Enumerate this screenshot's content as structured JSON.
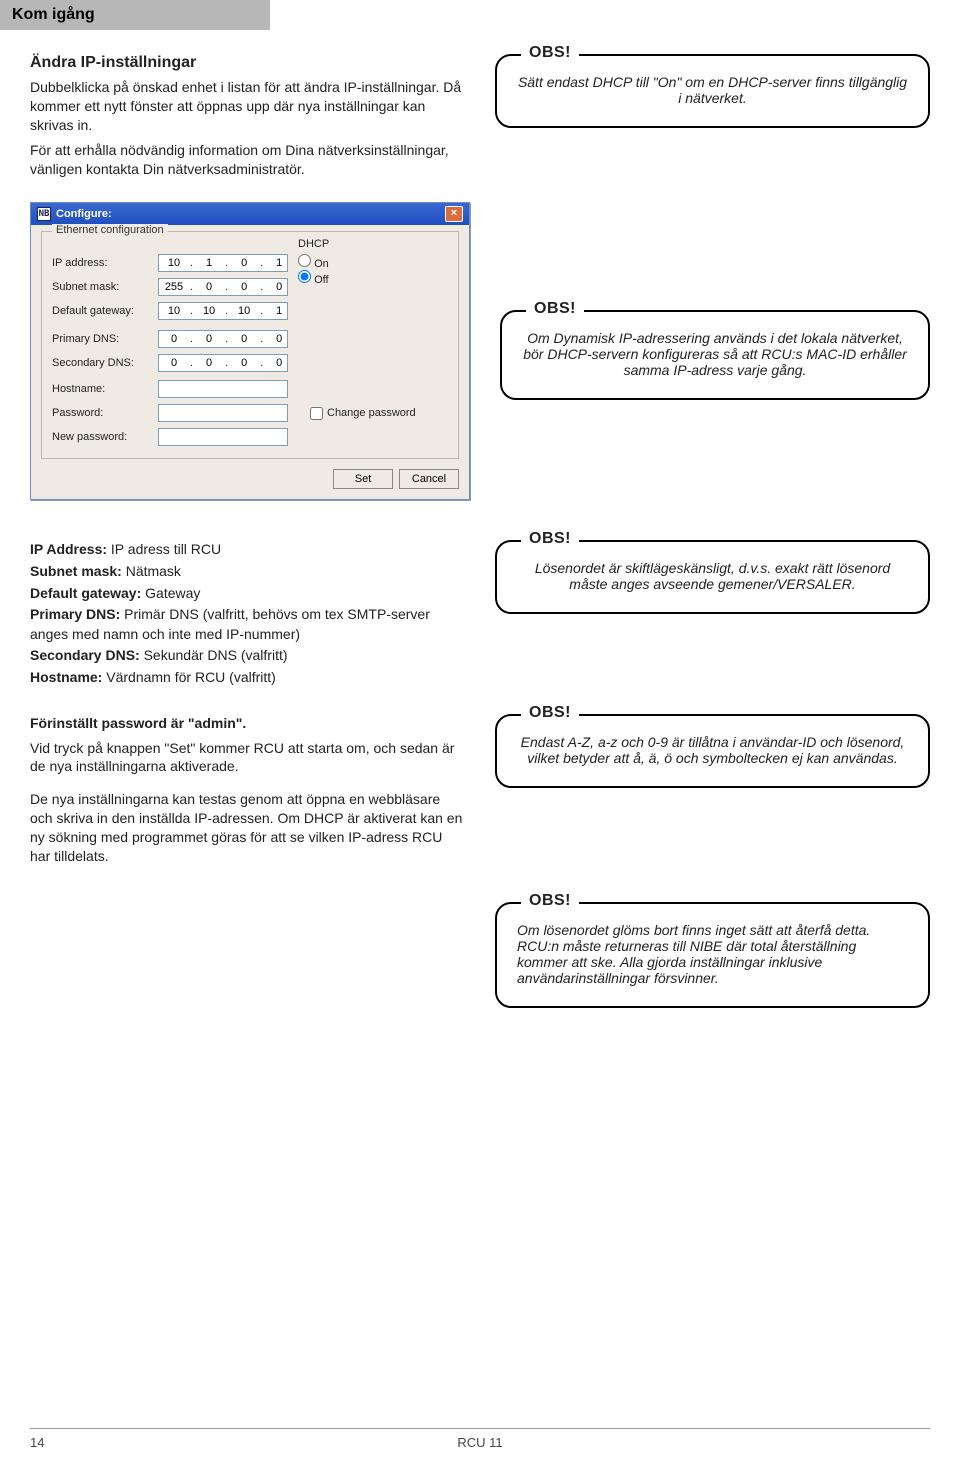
{
  "header_band": "Kom igång",
  "section1": {
    "title": "Ändra IP-inställningar",
    "p1": "Dubbelklicka på önskad enhet i listan för att ändra IP-inställningar. Då kommer ett nytt fönster att öppnas upp där nya inställningar kan skrivas in.",
    "p2": "För att erhålla nödvändig information om Dina nätverksinställningar, vänligen kontakta Din nätverksadministratör."
  },
  "callout1": {
    "legend": "OBS!",
    "text": "Sätt endast DHCP till \"On\" om en DHCP-server finns tillgänglig i nätverket."
  },
  "callout2": {
    "legend": "OBS!",
    "text": "Om Dynamisk IP-adressering används i det lokala nätverket, bör DHCP-servern konfigureras så att RCU:s MAC-ID erhåller samma IP-adress varje gång."
  },
  "callout3": {
    "legend": "OBS!",
    "text": "Lösenordet är skiftlägeskänsligt, d.v.s. exakt rätt lösenord måste anges avseende gemener/VERSALER."
  },
  "callout4": {
    "legend": "OBS!",
    "text": "Endast A-Z, a-z och 0-9 är tillåtna i användar-ID och lösenord, vilket betyder att å, ä, ö och symboltecken ej kan användas."
  },
  "callout5": {
    "legend": "OBS!",
    "text": "Om lösenordet glöms bort finns inget sätt att återfå detta. RCU:n måste returneras till NIBE där total återställning kommer att ske. Alla gjorda inställningar inklusive användarinställningar försvinner."
  },
  "dialog": {
    "title": "Configure:",
    "fieldset_legend": "Ethernet configuration",
    "labels": {
      "ip": "IP address:",
      "subnet": "Subnet mask:",
      "gw": "Default gateway:",
      "pdns": "Primary DNS:",
      "sdns": "Secondary DNS:",
      "host": "Hostname:",
      "pw": "Password:",
      "npw": "New password:",
      "dhcp": "DHCP",
      "on": "On",
      "off": "Off",
      "chgpw": "Change password"
    },
    "values": {
      "ip": [
        "10",
        "1",
        "0",
        "1"
      ],
      "subnet": [
        "255",
        "0",
        "0",
        "0"
      ],
      "gw": [
        "10",
        "10",
        "10",
        "1"
      ],
      "pdns": [
        "0",
        "0",
        "0",
        "0"
      ],
      "sdns": [
        "0",
        "0",
        "0",
        "0"
      ]
    },
    "buttons": {
      "set": "Set",
      "cancel": "Cancel"
    }
  },
  "defs": {
    "ip_b": "IP Address:",
    "ip_t": " IP adress till RCU",
    "sn_b": "Subnet mask:",
    "sn_t": " Nätmask",
    "gw_b": "Default gateway:",
    "gw_t": " Gateway",
    "pd_b": "Primary DNS:",
    "pd_t": " Primär DNS (valfritt, behövs om tex SMTP-server anges med namn och inte med IP-nummer)",
    "sd_b": "Secondary DNS:",
    "sd_t": " Sekundär DNS (valfritt)",
    "hn_b": "Hostname:",
    "hn_t": " Värdnamn för RCU (valfritt)"
  },
  "para2": {
    "l1b": "Förinställt password är \"admin\".",
    "l2": "Vid tryck på knappen \"Set\" kommer RCU att starta om, och sedan är de nya inställningarna aktiverade.",
    "l3": "De nya inställningarna kan testas genom att öppna en webbläsare och skriva in den inställda IP-adressen. Om DHCP är aktiverat kan en ny sökning med programmet göras för att se vilken IP-adress RCU har tilldelats."
  },
  "footer": {
    "page": "14",
    "model": "RCU 11"
  }
}
